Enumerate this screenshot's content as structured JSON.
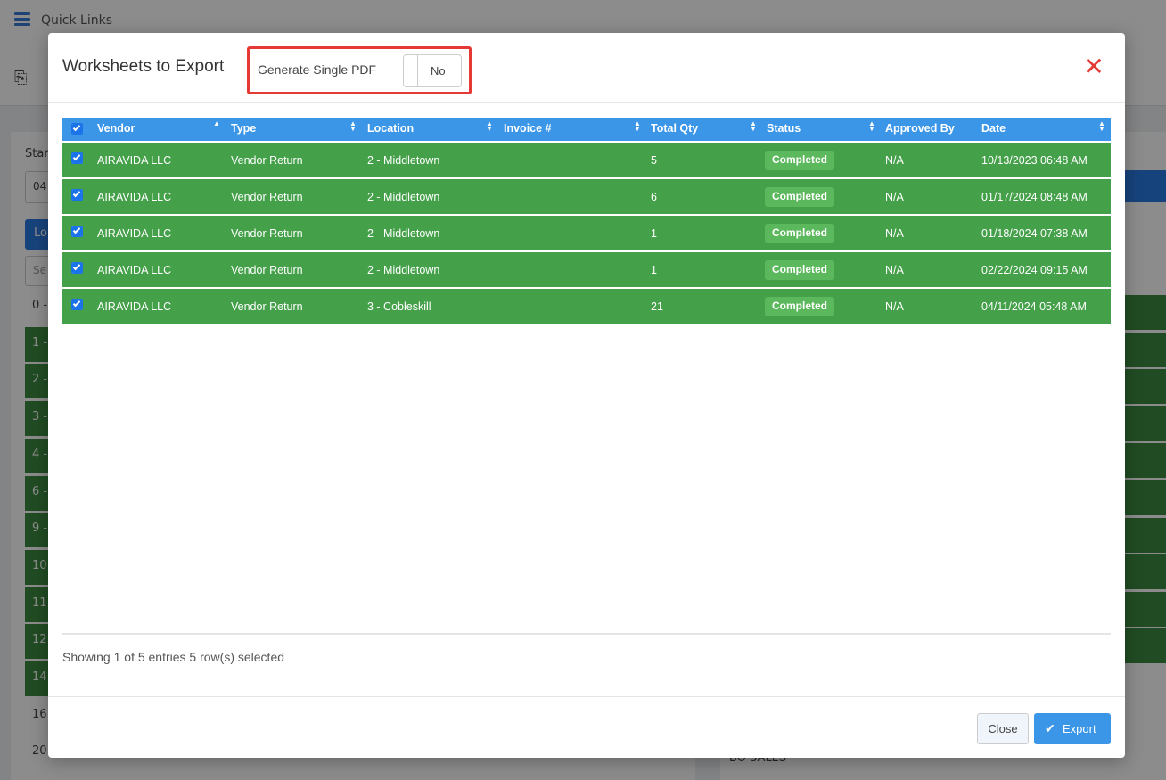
{
  "background": {
    "topbar_title": "Quick Links",
    "start_label": "Star",
    "start_value": "04",
    "load_button": "Lo",
    "search_placeholder": "Se",
    "left_rows": [
      "0 -",
      "1 -",
      "2 -",
      "3 -",
      "4 -",
      "6 -",
      "9 -",
      "10",
      "11",
      "12",
      "14",
      "16",
      "20"
    ],
    "right_bottom_text": "BO SALES"
  },
  "modal": {
    "title": "Worksheets to Export",
    "single_pdf_label": "Generate Single PDF",
    "single_pdf_toggle": "No",
    "close_icon": "close-icon"
  },
  "table": {
    "columns": [
      "Vendor",
      "Type",
      "Location",
      "Invoice #",
      "Total Qty",
      "Status",
      "Approved By",
      "Date"
    ],
    "rows": [
      {
        "vendor": "AIRAVIDA LLC",
        "type": "Vendor Return",
        "location": "2 - Middletown",
        "invoice": "",
        "qty": "5",
        "status": "Completed",
        "approved_by": "N/A",
        "date": "10/13/2023 06:48 AM"
      },
      {
        "vendor": "AIRAVIDA LLC",
        "type": "Vendor Return",
        "location": "2 - Middletown",
        "invoice": "",
        "qty": "6",
        "status": "Completed",
        "approved_by": "N/A",
        "date": "01/17/2024 08:48 AM"
      },
      {
        "vendor": "AIRAVIDA LLC",
        "type": "Vendor Return",
        "location": "2 - Middletown",
        "invoice": "",
        "qty": "1",
        "status": "Completed",
        "approved_by": "N/A",
        "date": "01/18/2024 07:38 AM"
      },
      {
        "vendor": "AIRAVIDA LLC",
        "type": "Vendor Return",
        "location": "2 - Middletown",
        "invoice": "",
        "qty": "1",
        "status": "Completed",
        "approved_by": "N/A",
        "date": "02/22/2024 09:15 AM"
      },
      {
        "vendor": "AIRAVIDA LLC",
        "type": "Vendor Return",
        "location": "3 - Cobleskill",
        "invoice": "",
        "qty": "21",
        "status": "Completed",
        "approved_by": "N/A",
        "date": "04/11/2024 05:48 AM"
      }
    ]
  },
  "footer": {
    "showing_text": "Showing 1 of 5 entries 5 row(s) selected",
    "close_button": "Close",
    "export_button": "Export"
  },
  "colors": {
    "header_blue": "#3b96e8",
    "row_green": "#45a04a",
    "badge_green": "#5cb85c",
    "highlight_red": "#e53935"
  }
}
